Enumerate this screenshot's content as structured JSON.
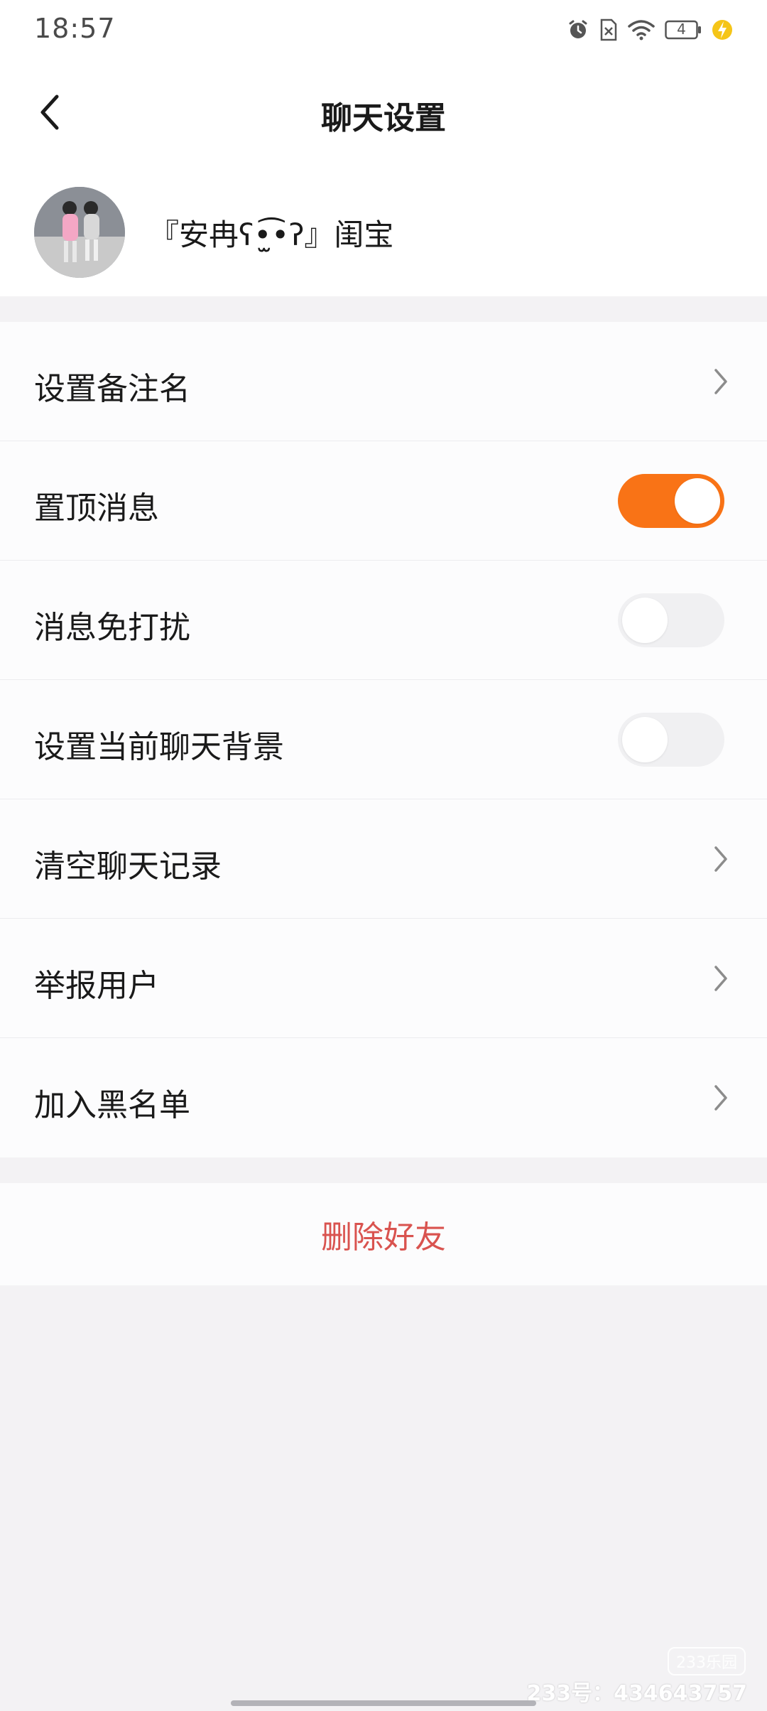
{
  "status_bar": {
    "time": "18:57",
    "battery_level": "4",
    "icons": [
      "alarm-icon",
      "no-sim-icon",
      "wifi-icon",
      "battery-icon",
      "charging-icon"
    ]
  },
  "header": {
    "title": "聊天设置",
    "back_icon": "chevron-left-icon"
  },
  "profile": {
    "name": "『安冉ʕ•̫͡•ʔ』闺宝",
    "avatar": "avatar-photo"
  },
  "settings": [
    {
      "label": "设置备注名",
      "control": "chevron"
    },
    {
      "label": "置顶消息",
      "control": "toggle",
      "on": true
    },
    {
      "label": "消息免打扰",
      "control": "toggle",
      "on": false
    },
    {
      "label": "设置当前聊天背景",
      "control": "toggle",
      "on": false
    },
    {
      "label": "清空聊天记录",
      "control": "chevron"
    },
    {
      "label": "举报用户",
      "control": "chevron"
    },
    {
      "label": "加入黑名单",
      "control": "chevron"
    }
  ],
  "delete_friend": {
    "label": "删除好友"
  },
  "watermark": {
    "logo": "233乐园",
    "id_text": "233号：434643757"
  },
  "colors": {
    "accent": "#f97316",
    "danger": "#d9534f",
    "background": "#f3f2f4"
  }
}
